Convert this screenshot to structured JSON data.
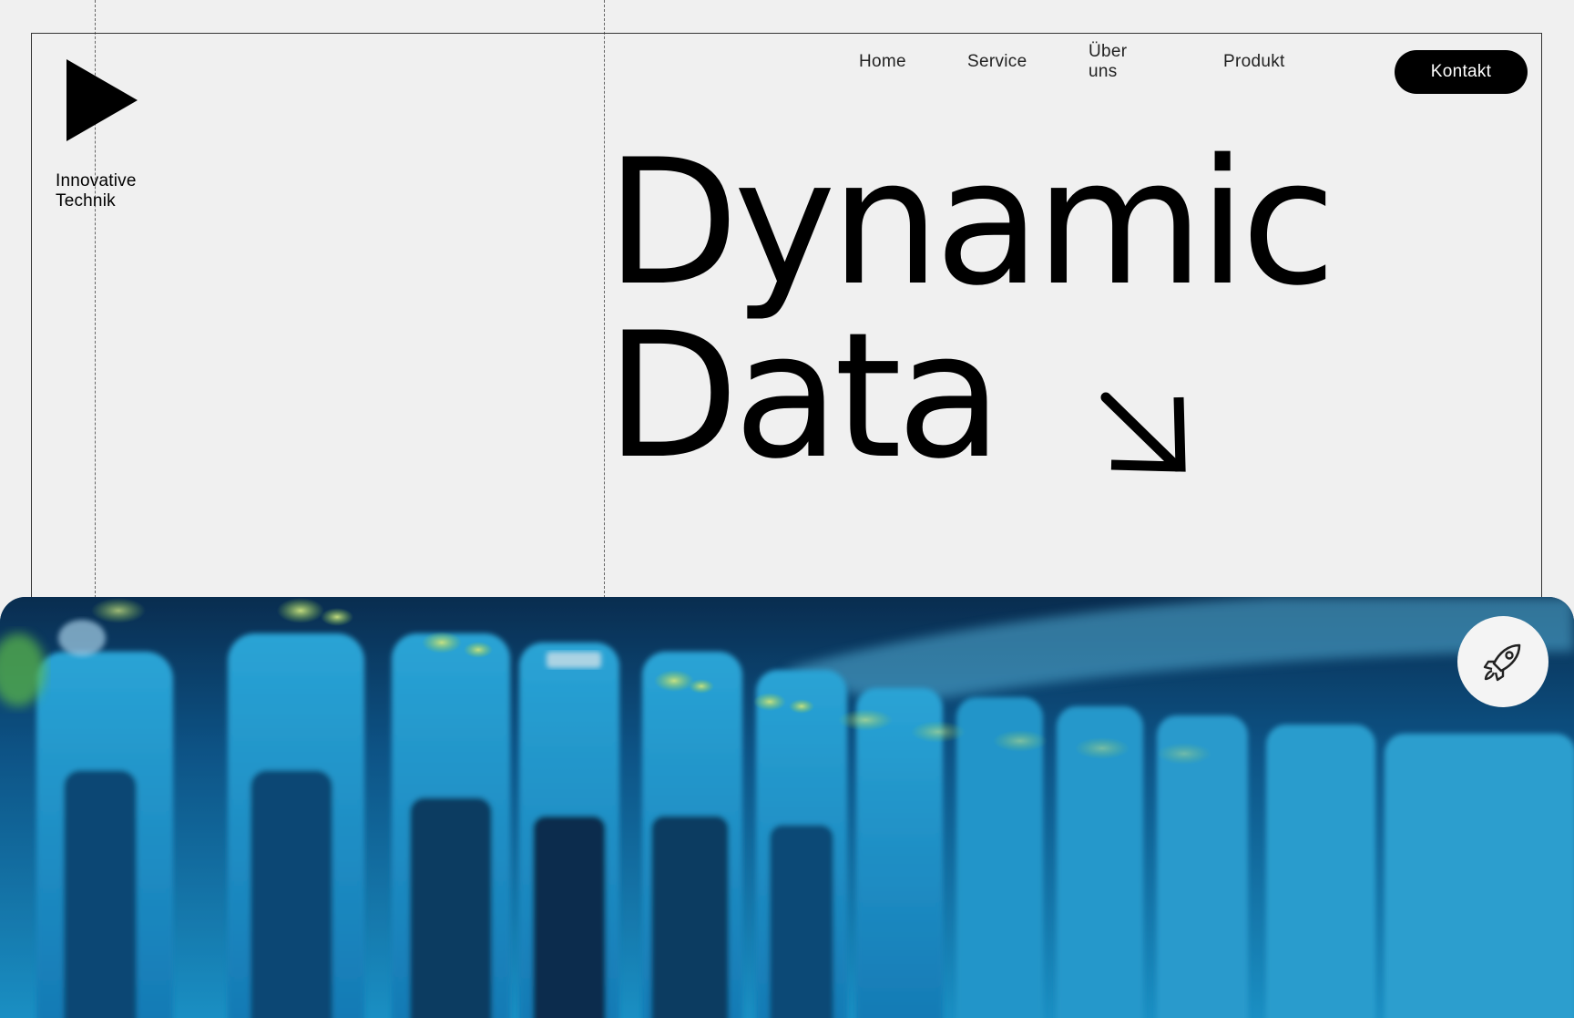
{
  "brand": {
    "name_line1": "Innovative",
    "name_line2": "Technik"
  },
  "nav": {
    "items": [
      "Home",
      "Service",
      "Über uns",
      "Produkt"
    ],
    "cta_label": "Kontakt"
  },
  "hero": {
    "headline_line1": "Dynamic",
    "headline_line2": "Data"
  },
  "icons": {
    "logo": "play-triangle-icon",
    "arrow": "arrow-down-right-icon",
    "rocket": "rocket-icon"
  },
  "colors": {
    "background": "#f0f0f0",
    "text": "#000000",
    "cta_bg": "#000000",
    "cta_text": "#ffffff",
    "image_accent": "#1aa0d6"
  }
}
